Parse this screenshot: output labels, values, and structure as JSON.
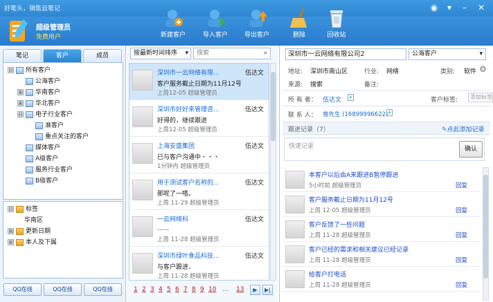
{
  "app": {
    "title": "好笔头，销售云笔记"
  },
  "user": {
    "name": "超级管理员",
    "type": "免费用户"
  },
  "toolbar": [
    {
      "label": "新建客户",
      "icon": "add-user-icon"
    },
    {
      "label": "导入客户",
      "icon": "import-icon"
    },
    {
      "label": "导出客户",
      "icon": "export-icon"
    },
    {
      "label": "删除",
      "icon": "broom-icon"
    },
    {
      "label": "回收站",
      "icon": "recycle-bin-icon"
    }
  ],
  "left": {
    "tabs": [
      "笔记",
      "客户",
      "成员"
    ],
    "tree": [
      {
        "label": "所有客户",
        "exp": "⊟",
        "indent": 0
      },
      {
        "label": "公海客户",
        "exp": "",
        "indent": 1
      },
      {
        "label": "华南客户",
        "exp": "⊞",
        "indent": 1
      },
      {
        "label": "华北客户",
        "exp": "⊞",
        "indent": 1
      },
      {
        "label": "电子行业客户",
        "exp": "⊟",
        "indent": 1
      },
      {
        "label": "准客户",
        "exp": "",
        "indent": 2
      },
      {
        "label": "重点关注的客户",
        "exp": "",
        "indent": 2
      },
      {
        "label": "媒体客户",
        "exp": "",
        "indent": 1
      },
      {
        "label": "A级客户",
        "exp": "",
        "indent": 1
      },
      {
        "label": "服务行业客户",
        "exp": "",
        "indent": 1
      },
      {
        "label": "B级客户",
        "exp": "",
        "indent": 1
      }
    ],
    "tree2": [
      {
        "label": "标签",
        "exp": "⊟"
      },
      {
        "label": "华南区",
        "exp": ""
      },
      {
        "label": "更新日期",
        "exp": "⊞"
      },
      {
        "label": "本人及下属",
        "exp": "⊞"
      }
    ],
    "qq": [
      "QQ在线",
      "QQ在线",
      "QQ在线"
    ]
  },
  "mid": {
    "sort": "按最新时间排序",
    "search": "搜索",
    "customers": [
      {
        "name": "深圳市一云网络有限...",
        "owner": "伍达文",
        "note": "客户服务截止日期为11月12号",
        "meta": "上周12-05  超级管理员"
      },
      {
        "name": "深圳市好好来管理咨...",
        "owner": "伍达文",
        "note": "好得的，继续跟进",
        "meta": "上周12-05  超级管理员"
      },
      {
        "name": "上海安盛集团",
        "owner": "伍达文",
        "note": "已与客户沟通中・・・",
        "meta": "1分钟内  超级管理员"
      },
      {
        "name": "用于测试客户名称的...",
        "owner": "伍达文",
        "note": "那呢了一嗒。",
        "meta": "上周 11-29  超级管理员"
      },
      {
        "name": "一云网络科",
        "owner": "伍达文",
        "note": "......",
        "meta": "上周 11-28  超级管理员"
      },
      {
        "name": "深圳市绿叶食品科技...",
        "owner": "伍达文",
        "note": "与客户跟进、",
        "meta": "上周 11-28  超级管理员"
      }
    ],
    "pages": [
      "1",
      "2",
      "3",
      "4",
      "5",
      "6",
      "7",
      "8",
      "9",
      "10",
      "...",
      "13"
    ]
  },
  "right": {
    "company": "深圳市一云网络有限公司2",
    "category": "公海客户",
    "address_label": "地址:",
    "address": "深圳市南山区",
    "industry_label": "行业:",
    "industry": "网络",
    "type_label": "类别:",
    "type": "软件",
    "source_label": "来源:",
    "source": "搜索",
    "remark_label": "备注:",
    "owner_label": "所 有 者：",
    "owner": "伍达文",
    "tag_label": "客户标签:",
    "tag_placeholder": "添加标签",
    "contact_label": "联 系 人：",
    "contact": "曾先生 (16899996622)",
    "records_label": "跟进记录（7）",
    "add_record": "点此添加记录",
    "quick_placeholder": "快速记录",
    "confirm": "确认",
    "records": [
      {
        "title": "本客户以后由A来跟进B暂停跟进",
        "meta": "5小时前  超级管理员",
        "reply": "回复"
      },
      {
        "title": "客户服务截止日期为11月12号",
        "meta": "上周 12-05  超级管理员",
        "reply": "回复"
      },
      {
        "title": "客户反馈了一些问题",
        "meta": "上周 11-28  超级管理员",
        "reply": "回复"
      },
      {
        "title": "客户已经的需求和相关建议已经记录",
        "meta": "上周 11-28  超级管理员",
        "reply": "回复"
      },
      {
        "title": "给客户打电话",
        "meta": "上周 11-28  超级管理员",
        "reply": "回复"
      }
    ]
  },
  "colors": {
    "accent": "#2f86d2",
    "link": "#1a6ad2",
    "selected": "#cfe6fa"
  }
}
